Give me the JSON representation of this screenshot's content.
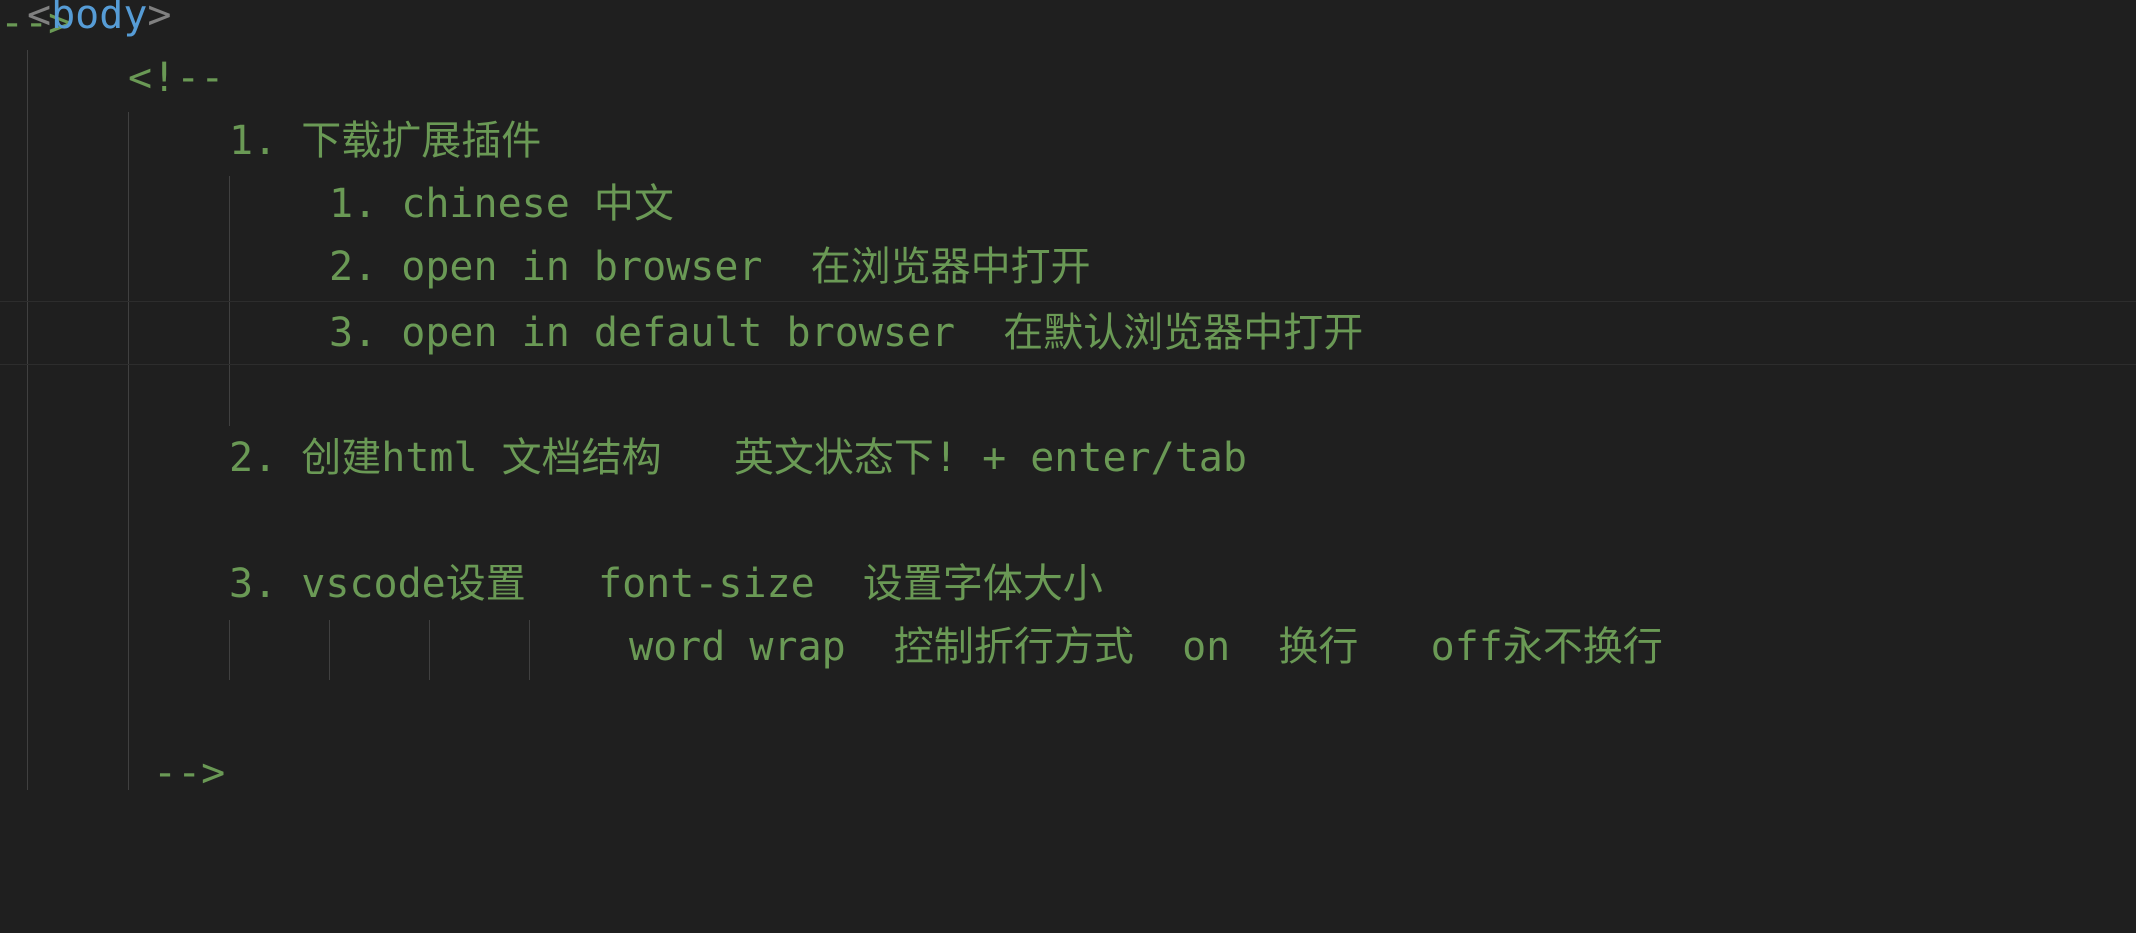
{
  "editor": {
    "lines": [
      {
        "bracket_open": "<",
        "tag": "body",
        "bracket_close": ">"
      },
      {
        "text": "<!--"
      },
      {
        "text": "1. 下载扩展插件"
      },
      {
        "text": "1. chinese 中文"
      },
      {
        "text": "2. open in browser  在浏览器中打开"
      },
      {
        "text": "3. open in default browser  在默认浏览器中打开"
      },
      {
        "text": ""
      },
      {
        "text": "2. 创建html 文档结构   英文状态下! + enter/tab"
      },
      {
        "text": ""
      },
      {
        "text": "3. vscode设置   font-size  设置字体大小"
      },
      {
        "text": "word wrap  控制折行方式  on  换行   off永不换行"
      },
      {
        "text": ""
      },
      {
        "text": "-->"
      }
    ]
  },
  "colors": {
    "background": "#1f1f1f",
    "comment": "#6a9955",
    "tag": "#569cd6",
    "bracket": "#808080",
    "indent_guide": "#404040"
  }
}
